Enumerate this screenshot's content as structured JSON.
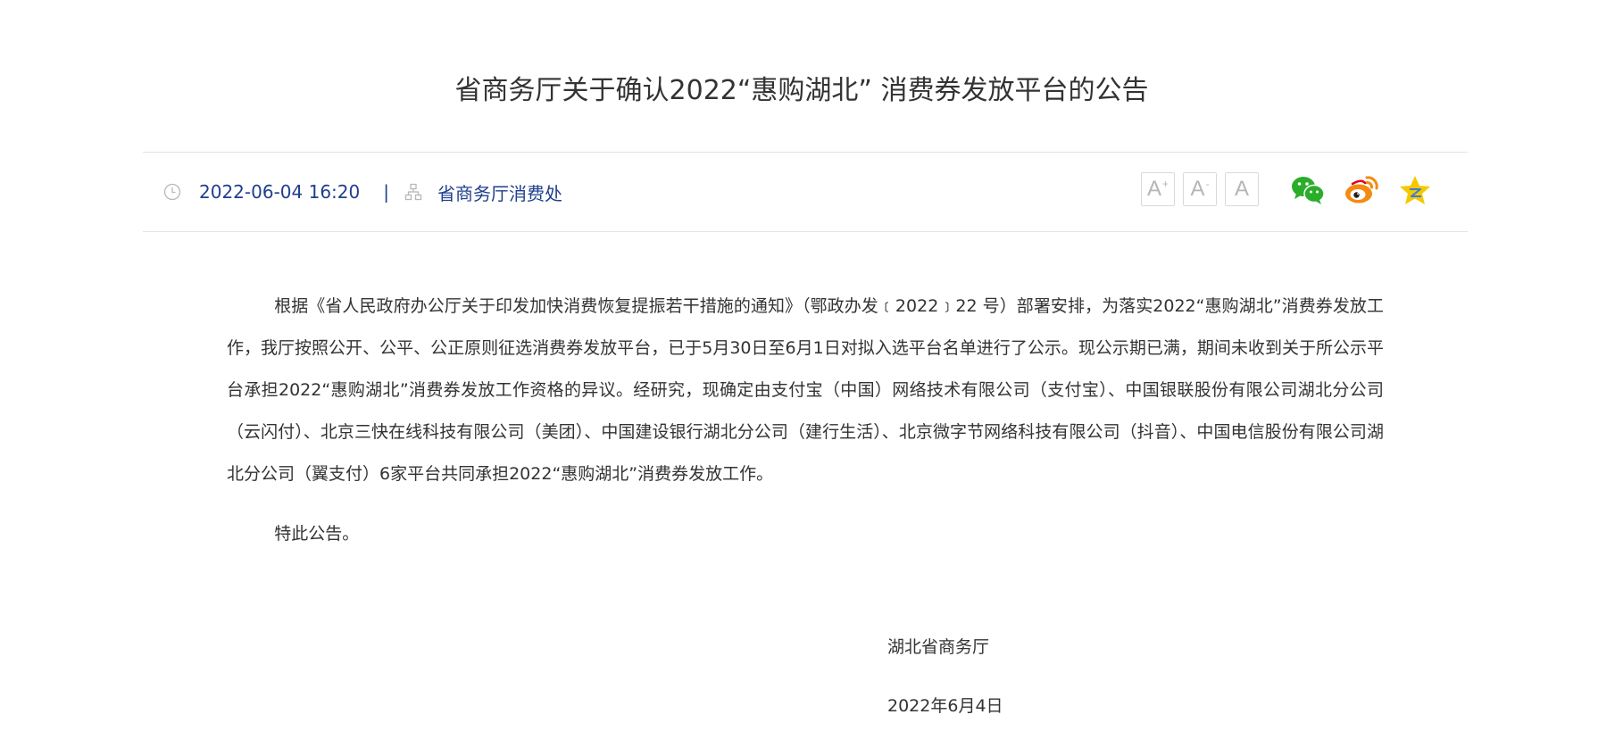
{
  "article": {
    "title": "省商务厅关于确认2022“惠购湖北” 消费券发放平台的公告",
    "date": "2022-06-04 16:20",
    "separator": "|",
    "source": "省商务厅消费处",
    "body": "根据《省人民政府办公厅关于印发加快消费恢复提振若干措施的通知》（鄂政办发﹝2022﹞22 号）部署安排，为落实2022“惠购湖北”消费券发放工作，我厅按照公开、公平、公正原则征选消费券发放平台，已于5月30日至6月1日对拟入选平台名单进行了公示。现公示期已满，期间未收到关于所公示平台承担2022“惠购湖北”消费券发放工作资格的异议。经研究，现确定由支付宝（中国）网络技术有限公司（支付宝）、中国银联股份有限公司湖北分公司（云闪付）、北京三快在线科技有限公司（美团）、中国建设银行湖北分公司（建行生活）、北京微字节网络科技有限公司（抖音）、中国电信股份有限公司湖北分公司（翼支付）6家平台共同承担2022“惠购湖北”消费券发放工作。",
    "closing": "特此公告。",
    "signature_org": "湖北省商务厅",
    "signature_date": "2022年6月4日"
  },
  "font_tools": {
    "increase_label": "A",
    "increase_mark": "+",
    "decrease_label": "A",
    "decrease_mark": "-",
    "reset_label": "A"
  },
  "share": {
    "icons": [
      "wechat-icon",
      "weibo-icon",
      "qzone-icon"
    ],
    "colors": {
      "wechat": "#2aae2a",
      "weibo": "#f38b12",
      "qzone": "#f7c800"
    }
  },
  "meta_icons": [
    "clock-icon",
    "sitemap-icon"
  ],
  "colors": {
    "meta_text": "#1f3f8c",
    "body_text": "#333333",
    "divider": "#e4e4e4"
  }
}
